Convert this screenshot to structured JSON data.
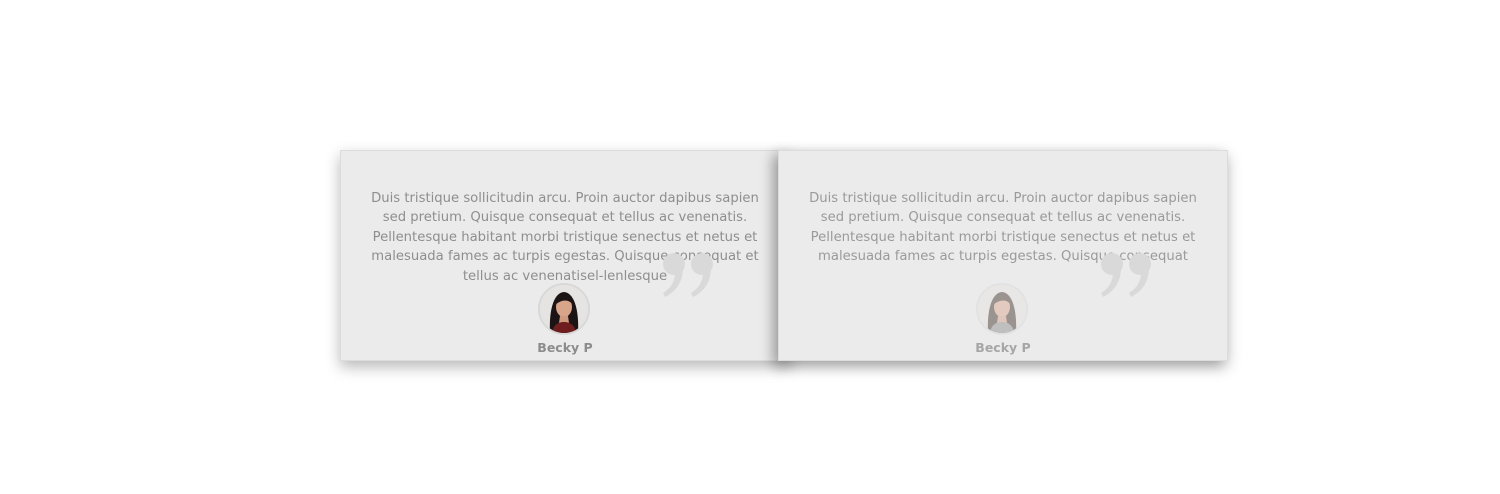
{
  "testimonials": [
    {
      "quote": "Duis tristique sollicitudin arcu. Proin auctor dapibus sapien sed pretium. Quisque consequat et tellus ac venenatis. Pellentesque habitant morbi tristique senectus et netus et malesuada fames ac turpis egestas. Quisque consequat et tellus ac venenatisel-lenlesque",
      "author": "Becky P",
      "avatar_icon": "person-avatar",
      "quote_icon": "closing-quote-icon"
    },
    {
      "quote": "Duis tristique sollicitudin arcu. Proin auctor dapibus sapien sed pretium. Quisque consequat et tellus ac venenatis. Pellentesque habitant morbi tristique senectus et netus et malesuada fames ac turpis egestas. Quisque consequat",
      "author": "Becky P",
      "avatar_icon": "person-avatar",
      "quote_icon": "closing-quote-icon"
    }
  ],
  "colors": {
    "card_background": "#ebebeb",
    "text": "#8e8e8e",
    "quote_mark": "#dcdcdc"
  }
}
